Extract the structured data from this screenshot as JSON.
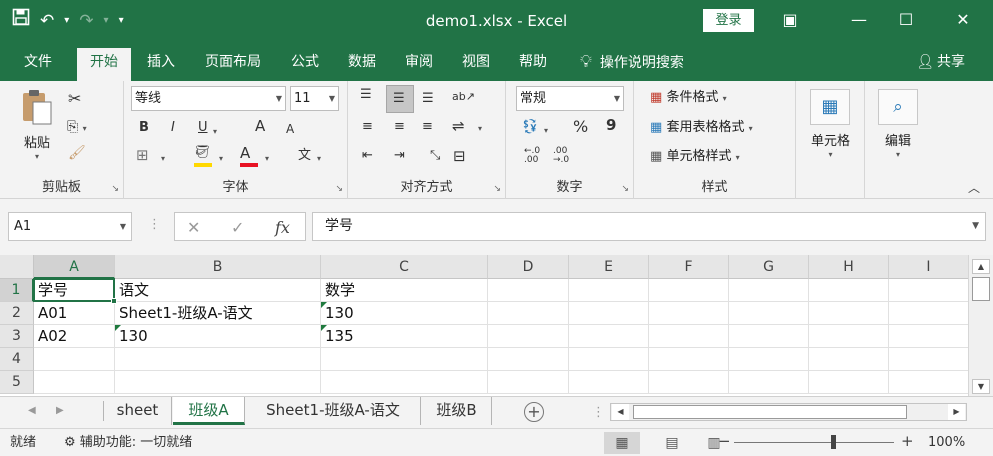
{
  "titlebar": {
    "title": "demo1.xlsx  -  Excel",
    "login_label": "登录",
    "undo_symbol": "↶",
    "redo_symbol": "↷",
    "save_symbol": "💾",
    "customize_symbol": "▾",
    "ribbon_display_symbol": "▣",
    "minimize_symbol": "—",
    "maximize_symbol": "☐",
    "close_symbol": "✕"
  },
  "tabs": [
    {
      "label": "文件"
    },
    {
      "label": "开始"
    },
    {
      "label": "插入"
    },
    {
      "label": "页面布局"
    },
    {
      "label": "公式"
    },
    {
      "label": "数据"
    },
    {
      "label": "审阅"
    },
    {
      "label": "视图"
    },
    {
      "label": "帮助"
    }
  ],
  "active_tab": "开始",
  "tellme": {
    "icon": "lightbulb-icon",
    "label": "操作说明搜索"
  },
  "share": {
    "icon": "person-icon",
    "label": "共享"
  },
  "ribbon": {
    "clipboard": {
      "label": "剪贴板",
      "paste_label": "粘贴"
    },
    "font": {
      "label": "字体",
      "font_name": "等线",
      "font_size": "11",
      "bold": "B",
      "italic": "I",
      "underline": "U",
      "grow": "A",
      "shrink": "A",
      "font_color_letter": "A",
      "highlight_color": "#ffd800",
      "font_color": "#e81123",
      "phonetic": "文"
    },
    "alignment": {
      "label": "对齐方式"
    },
    "number": {
      "label": "数字",
      "format": "常规",
      "percent": "%",
      "comma": "9",
      "increase_decimal": "←.0\n.00",
      "decrease_decimal": ".00\n→.0"
    },
    "styles": {
      "label": "样式",
      "conditional_format": "条件格式",
      "format_as_table": "套用表格格式",
      "cell_styles": "单元格样式"
    },
    "cells": {
      "label": "单元格"
    },
    "editing": {
      "label": "编辑"
    }
  },
  "formula_bar": {
    "name_box": "A1",
    "content": "学号",
    "cancel_symbol": "✕",
    "enter_symbol": "✓",
    "fx_symbol": "fx"
  },
  "grid": {
    "columns": [
      "A",
      "B",
      "C",
      "D",
      "E",
      "F",
      "G",
      "H",
      "I"
    ],
    "rows": [
      "1",
      "2",
      "3",
      "4",
      "5"
    ],
    "selected_cell": "A1",
    "cells": {
      "A1": "学号",
      "B1": "语文",
      "C1": "数学",
      "A2": "A01",
      "B2": "Sheet1-班级A-语文",
      "C2": "130",
      "A3": "A02",
      "B3": "130",
      "C3": "135"
    },
    "number_as_text_cells": [
      "C2",
      "B3",
      "C3"
    ]
  },
  "sheets": [
    {
      "label": "sheet"
    },
    {
      "label": "班级A"
    },
    {
      "label": "Sheet1-班级A-语文"
    },
    {
      "label": "班级B"
    }
  ],
  "active_sheet": "班级A",
  "add_sheet_symbol": "+",
  "statusbar": {
    "ready": "就绪",
    "accessibility": "辅助功能: 一切就绪",
    "zoom": "100%",
    "zoom_minus": "−",
    "zoom_plus": "+"
  },
  "colors": {
    "brand": "#217346",
    "error_indicator": "#1f7a3e"
  }
}
